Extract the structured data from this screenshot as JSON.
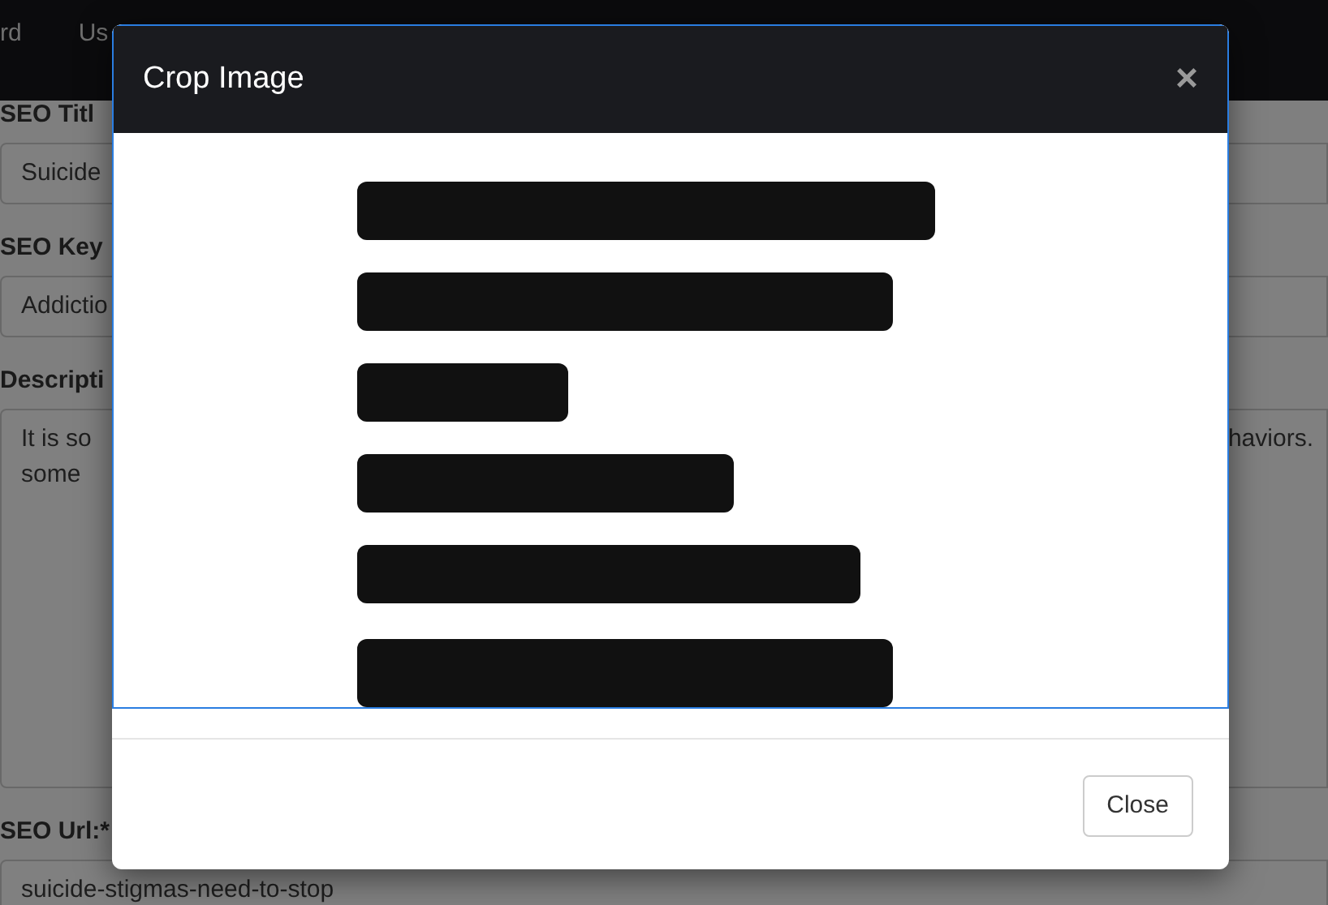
{
  "navbar": {
    "items": [
      "rd",
      "Us"
    ]
  },
  "form": {
    "fields": [
      {
        "kind": "input",
        "label": "SEO Titl",
        "value": "Suicide"
      },
      {
        "kind": "input",
        "label": "SEO Key",
        "value": "Addictio"
      },
      {
        "kind": "textarea",
        "label": "Descripti",
        "lines": [
          "It is so",
          "some"
        ],
        "value_right": "haviors."
      },
      {
        "kind": "input",
        "label": "SEO Url:*",
        "value": "suicide-stigmas-need-to-stop"
      }
    ]
  },
  "modal": {
    "title": "Crop Image",
    "close": "×",
    "image": {
      "kind": "picture"
    },
    "buttons": [
      "Close"
    ]
  }
}
